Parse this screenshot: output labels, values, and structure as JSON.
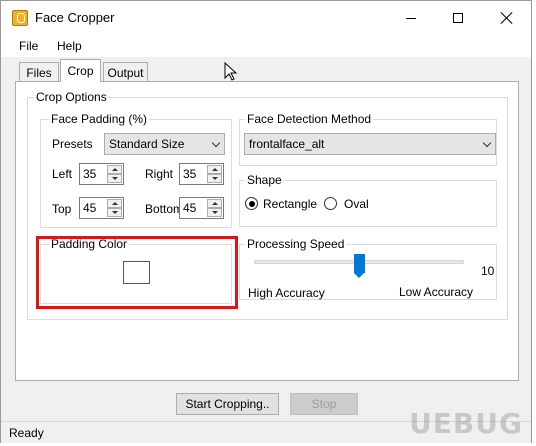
{
  "window": {
    "title": "Face Cropper",
    "app_icon": "face-cropper-app-icon"
  },
  "menu": {
    "file": "File",
    "help": "Help"
  },
  "tabs": {
    "files": "Files",
    "crop": "Crop",
    "output": "Output"
  },
  "crop_options": {
    "title": "Crop Options",
    "face_padding": {
      "title": "Face Padding (%)",
      "presets_label": "Presets",
      "presets_value": "Standard Size",
      "left_label": "Left",
      "left_value": "35",
      "right_label": "Right",
      "right_value": "35",
      "top_label": "Top",
      "top_value": "45",
      "bottom_label": "Bottom",
      "bottom_value": "45"
    },
    "padding_color": {
      "title": "Padding Color",
      "color": "#ffffff",
      "highlight_color": "#d11a1a"
    },
    "face_detection": {
      "title": "Face Detection Method",
      "value": "frontalface_alt"
    },
    "shape": {
      "title": "Shape",
      "rectangle": "Rectangle",
      "oval": "Oval",
      "selected": "Rectangle"
    },
    "processing_speed": {
      "title": "Processing Speed",
      "value": "10",
      "level_fraction": 0.5,
      "left_label": "High Accuracy",
      "right_label": "Low Accuracy",
      "accent": "#0078d7"
    }
  },
  "buttons": {
    "start": "Start Cropping..",
    "stop": "Stop"
  },
  "status": {
    "text": "Ready"
  },
  "watermark": {
    "text": "UEBUG"
  }
}
